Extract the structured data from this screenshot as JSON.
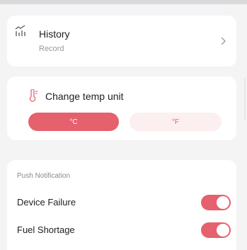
{
  "history": {
    "title": "History",
    "subtitle": "Record",
    "icon": "chart-line-icon"
  },
  "temp_unit": {
    "title": "Change temp unit",
    "icon": "thermometer-icon",
    "options": [
      "°C",
      "°F"
    ],
    "selected": "°C"
  },
  "push": {
    "section_label": "Push Notification",
    "items": [
      {
        "label": "Device Failure",
        "enabled": true
      },
      {
        "label": "Fuel Shortage",
        "enabled": true
      }
    ]
  },
  "colors": {
    "accent": "#e5616d",
    "accent_light": "#fbeff0",
    "background": "#f4f4f5"
  }
}
